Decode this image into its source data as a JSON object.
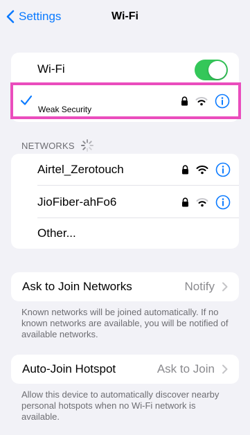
{
  "nav": {
    "back_label": "Settings",
    "title": "Wi-Fi"
  },
  "wifi_toggle": {
    "label": "Wi-Fi",
    "state": "on"
  },
  "current_network": {
    "status": "Weak Security"
  },
  "networks_section": {
    "header": "NETWORKS"
  },
  "networks": [
    {
      "name": "Airtel_Zerotouch"
    },
    {
      "name": "JioFiber-ahFo6"
    }
  ],
  "other_label": "Other...",
  "ask_to_join": {
    "label": "Ask to Join Networks",
    "value": "Notify",
    "footnote": "Known networks will be joined automatically. If no known networks are available, you will be notified of available networks."
  },
  "auto_join": {
    "label": "Auto-Join Hotspot",
    "value": "Ask to Join",
    "footnote": "Allow this device to automatically discover nearby personal hotspots when no Wi-Fi network is available."
  },
  "colors": {
    "accent": "#0a7aff",
    "toggle_on": "#34c759",
    "highlight": "#ea4dbd"
  }
}
